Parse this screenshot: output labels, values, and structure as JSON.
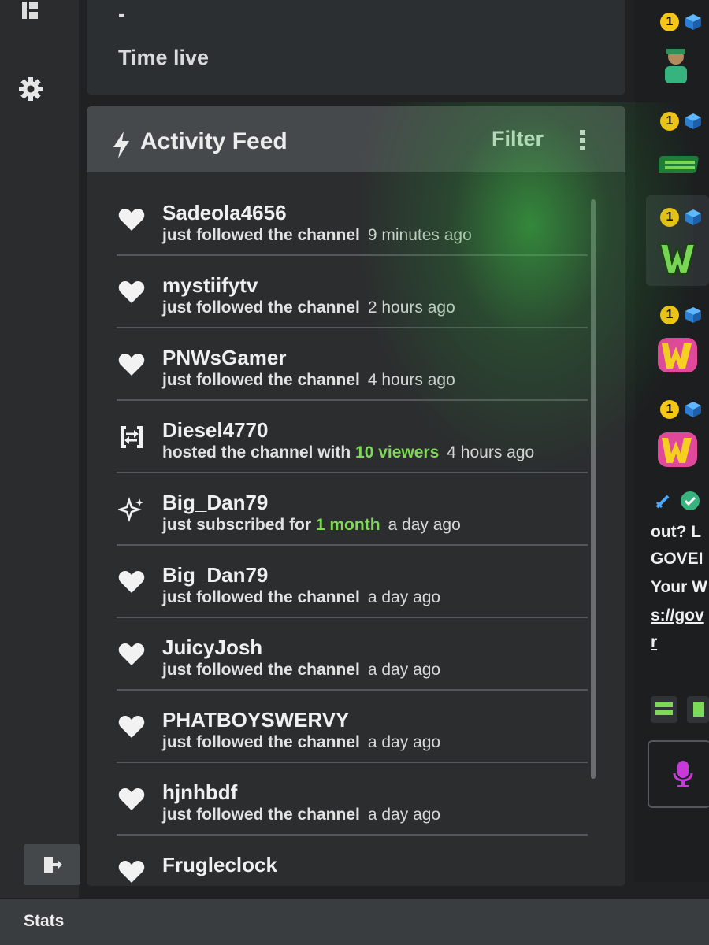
{
  "stats_panel": {
    "dash": "-",
    "label": "Time live"
  },
  "activity_feed": {
    "title": "Activity Feed",
    "filter_label": "Filter",
    "items": [
      {
        "icon": "heart-icon",
        "name": "Sadeola4656",
        "action": "just followed the channel",
        "time": "9 minutes ago"
      },
      {
        "icon": "heart-icon",
        "name": "mystiifytv",
        "action": "just followed the channel",
        "time": "2 hours ago"
      },
      {
        "icon": "heart-icon",
        "name": "PNWsGamer",
        "action": "just followed the channel",
        "time": "4 hours ago"
      },
      {
        "icon": "host-icon",
        "name": "Diesel4770",
        "action": "hosted the channel with",
        "highlight": "10 viewers",
        "time": "4 hours ago"
      },
      {
        "icon": "sparkle-icon",
        "name": "Big_Dan79",
        "action": "just subscribed for",
        "highlight": "1 month",
        "time": "a day ago"
      },
      {
        "icon": "heart-icon",
        "name": "Big_Dan79",
        "action": "just followed the channel",
        "time": "a day ago"
      },
      {
        "icon": "heart-icon",
        "name": "JuicyJosh",
        "action": "just followed the channel",
        "time": "a day ago"
      },
      {
        "icon": "heart-icon",
        "name": "PHATBOYSWERVY",
        "action": "just followed the channel",
        "time": "a day ago"
      },
      {
        "icon": "heart-icon",
        "name": "hjnhbdf",
        "action": "just followed the channel",
        "time": "a day ago"
      },
      {
        "icon": "heart-icon",
        "name": "Frugleclock",
        "action": "",
        "time": ""
      }
    ]
  },
  "chat": {
    "badge_text": "1",
    "lines": [
      "out? L",
      "GOVEI",
      "Your W",
      "s://gov",
      "r"
    ]
  },
  "bottom_bar": {
    "label": "Stats"
  },
  "colors": {
    "accent_green": "#7ed957",
    "glow_green": "#3cd246",
    "badge_gold": "#f5c518"
  }
}
